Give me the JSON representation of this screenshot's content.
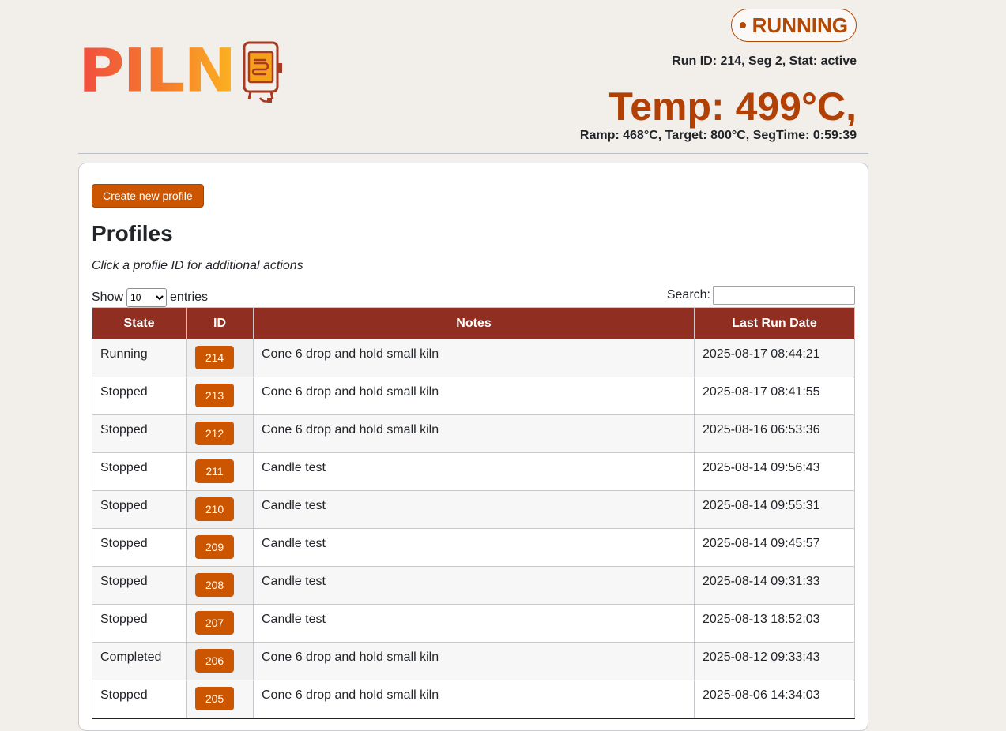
{
  "logo": {
    "text": "PILN",
    "icon": "kiln-icon"
  },
  "status": {
    "label": "RUNNING",
    "color": "#b24a05"
  },
  "run_info": "Run ID: 214, Seg 2, Stat: active",
  "temperature": "Temp: 499°C,",
  "ramp_info": "Ramp: 468°C, Target: 800°C, SegTime: 0:59:39",
  "create_button": "Create new profile",
  "profiles": {
    "title": "Profiles",
    "hint": "Click a profile ID for additional actions",
    "show_label": "Show",
    "entries_value": "10",
    "entries_label": "entries",
    "search_label": "Search:",
    "columns": [
      "State",
      "ID",
      "Notes",
      "Last Run Date"
    ],
    "rows": [
      {
        "state": "Running",
        "id": "214",
        "notes": "Cone 6 drop and hold small kiln",
        "date": "2025-08-17 08:44:21"
      },
      {
        "state": "Stopped",
        "id": "213",
        "notes": "Cone 6 drop and hold small kiln",
        "date": "2025-08-17 08:41:55"
      },
      {
        "state": "Stopped",
        "id": "212",
        "notes": "Cone 6 drop and hold small kiln",
        "date": "2025-08-16 06:53:36"
      },
      {
        "state": "Stopped",
        "id": "211",
        "notes": "Candle test",
        "date": "2025-08-14 09:56:43"
      },
      {
        "state": "Stopped",
        "id": "210",
        "notes": "Candle test",
        "date": "2025-08-14 09:55:31"
      },
      {
        "state": "Stopped",
        "id": "209",
        "notes": "Candle test",
        "date": "2025-08-14 09:45:57"
      },
      {
        "state": "Stopped",
        "id": "208",
        "notes": "Candle test",
        "date": "2025-08-14 09:31:33"
      },
      {
        "state": "Stopped",
        "id": "207",
        "notes": "Candle test",
        "date": "2025-08-13 18:52:03"
      },
      {
        "state": "Completed",
        "id": "206",
        "notes": "Cone 6 drop and hold small kiln",
        "date": "2025-08-12 09:33:43"
      },
      {
        "state": "Stopped",
        "id": "205",
        "notes": "Cone 6 drop and hold small kiln",
        "date": "2025-08-06 14:34:03"
      }
    ]
  },
  "colors": {
    "accent": "#cc5500",
    "header_row": "#902e22",
    "temp": "#b24005",
    "background": "#f2eeea"
  }
}
